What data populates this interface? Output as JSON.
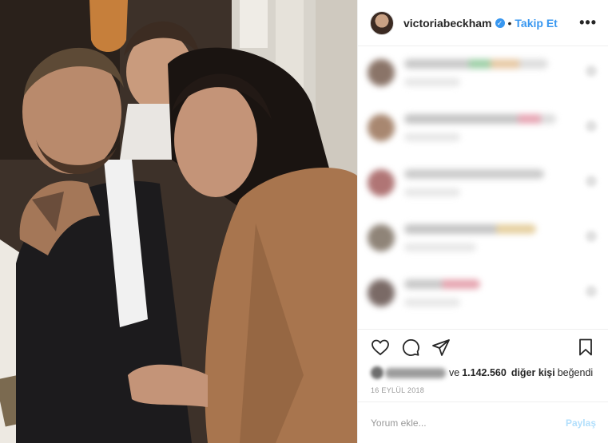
{
  "post": {
    "username": "victoriabeckham",
    "separator": "•",
    "follow_label": "Takip Et",
    "more_label": "•••",
    "likes": {
      "prefix": "ve",
      "count": "1.142.560",
      "suffix_bold": "diğer kişi",
      "suffix": "beğendi"
    },
    "date": "16 EYLÜL 2018"
  },
  "comment_box": {
    "placeholder": "Yorum ekle...",
    "post_label": "Paylaş"
  },
  "colors": {
    "link_blue": "#3897f0",
    "post_button_disabled": "#b2dffc",
    "verified_badge": "#3897f0"
  },
  "icons": [
    "heart-icon",
    "comment-icon",
    "share-icon",
    "bookmark-icon",
    "verified-badge-icon",
    "more-icon"
  ]
}
